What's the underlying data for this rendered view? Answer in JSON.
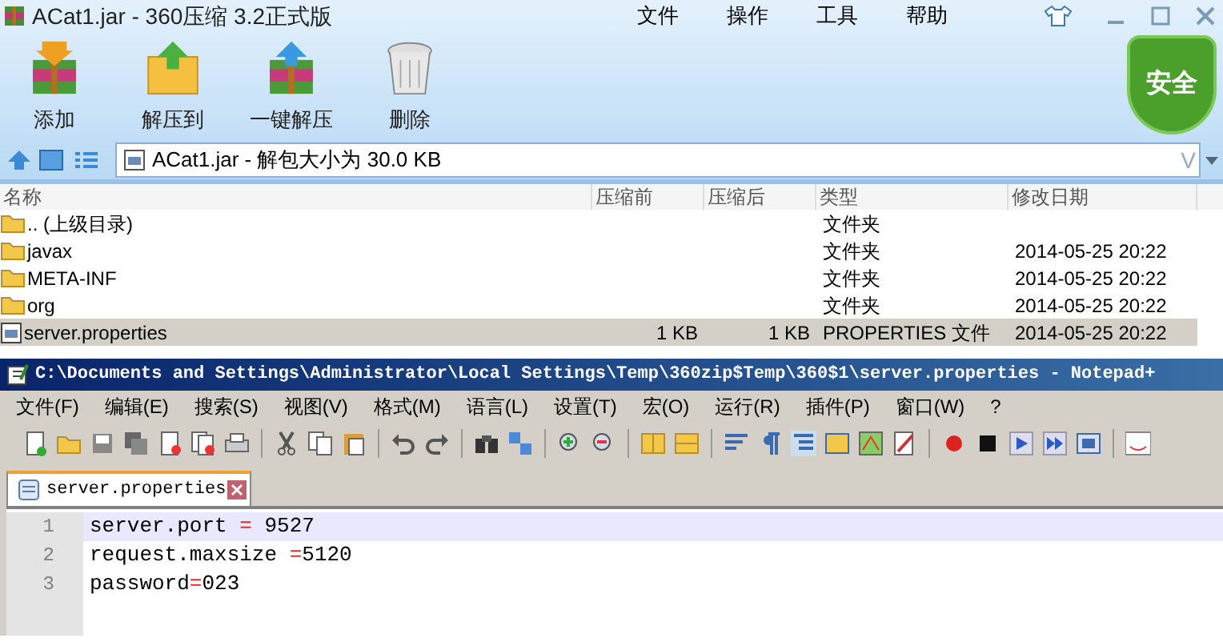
{
  "window": {
    "title": "ACat1.jar - 360压缩 3.2正式版"
  },
  "menu": [
    "文件",
    "操作",
    "工具",
    "帮助"
  ],
  "toolbar": [
    {
      "kind": "add",
      "label": "添加"
    },
    {
      "kind": "extract",
      "label": "解压到"
    },
    {
      "kind": "oneclick",
      "label": "一键解压"
    },
    {
      "kind": "delete",
      "label": "删除"
    }
  ],
  "security_badge": "安全",
  "address": {
    "value": "ACat1.jar - 解包大小为 30.0 KB",
    "dropdown": "V"
  },
  "table": {
    "columns": [
      "名称",
      "压缩前",
      "压缩后",
      "类型",
      "修改日期"
    ],
    "rows": [
      {
        "kind": "folder",
        "name": ".. (上级目录)",
        "before": "",
        "after": "",
        "type": "文件夹",
        "date": "",
        "selected": false
      },
      {
        "kind": "folder",
        "name": "javax",
        "type": "文件夹",
        "date": "2014-05-25 20:22",
        "selected": false
      },
      {
        "kind": "folder",
        "name": "META-INF",
        "type": "文件夹",
        "date": "2014-05-25 20:22",
        "selected": false
      },
      {
        "kind": "folder",
        "name": "org",
        "type": "文件夹",
        "date": "2014-05-25 20:22",
        "selected": false
      },
      {
        "kind": "file",
        "name": "server.properties",
        "before": "1 KB",
        "after": "1 KB",
        "type": "PROPERTIES 文件",
        "date": "2014-05-25 20:22",
        "selected": true
      }
    ]
  },
  "editor": {
    "title": "C:\\Documents and Settings\\Administrator\\Local Settings\\Temp\\360zip$Temp\\360$1\\server.properties - Notepad+",
    "menu": [
      "文件(F)",
      "编辑(E)",
      "搜索(S)",
      "视图(V)",
      "格式(M)",
      "语言(L)",
      "设置(T)",
      "宏(O)",
      "运行(R)",
      "插件(P)",
      "窗口(W)",
      "?"
    ],
    "tabs": [
      {
        "label": "server.properties",
        "selected": true
      }
    ],
    "lines": [
      {
        "number": "1",
        "key": "server.port ",
        "op": "=",
        "value": " 9527",
        "current": true
      },
      {
        "number": "2",
        "key": "request.maxsize ",
        "op": "=",
        "value": "5120",
        "current": false
      },
      {
        "number": "3",
        "key": "password",
        "op": "=",
        "value": "023",
        "current": false
      }
    ]
  }
}
